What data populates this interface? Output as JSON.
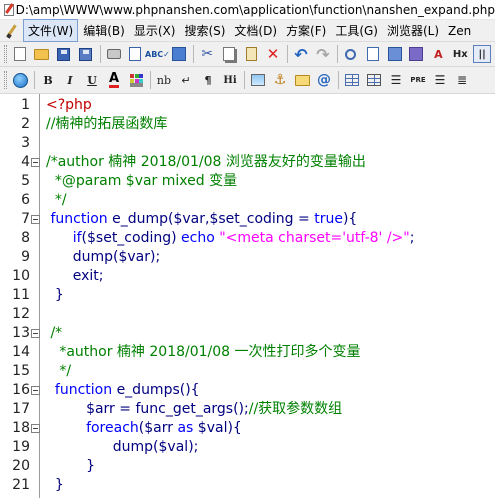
{
  "window": {
    "title": "D:\\amp\\WWW\\www.phpnanshen.com\\application\\function\\nanshen_expand.php"
  },
  "menu": [
    {
      "label": "文件(W)",
      "active": true
    },
    {
      "label": "编辑(B)"
    },
    {
      "label": "显示(X)"
    },
    {
      "label": "搜索(S)"
    },
    {
      "label": "文档(D)"
    },
    {
      "label": "方案(F)"
    },
    {
      "label": "工具(G)"
    },
    {
      "label": "浏览器(L)"
    },
    {
      "label": "Zen"
    }
  ],
  "toolbar1": [
    "new-document-icon",
    "open-folder-icon",
    "save-icon",
    "save-all-icon",
    "print-icon",
    "print-preview-icon",
    "spellcheck-icon",
    "validate-icon",
    "cut-icon",
    "copy-icon",
    "paste-icon",
    "delete-icon",
    "undo-icon",
    "redo-icon",
    "find-icon",
    "replace-icon",
    "goto-icon",
    "tag-icon",
    "heading-icon",
    "hx-icon",
    "h1-icon"
  ],
  "toolbar2": {
    "bold": "B",
    "italic": "I",
    "underline": "U",
    "nbsp": "nb",
    "pilcrow": "¶",
    "hi": "Hi",
    "pre": "PRE"
  },
  "code_lines": [
    {
      "n": "1",
      "fold": false,
      "segs": [
        [
          "php",
          "<?php"
        ]
      ]
    },
    {
      "n": "2",
      "fold": false,
      "segs": [
        [
          "cmt",
          "//楠神的拓展函数库"
        ]
      ]
    },
    {
      "n": "3",
      "fold": false,
      "segs": []
    },
    {
      "n": "4",
      "fold": true,
      "segs": [
        [
          "cmt",
          "/*author 楠神 2018/01/08 浏览器友好的变量输出"
        ]
      ]
    },
    {
      "n": "5",
      "fold": false,
      "segs": [
        [
          "cmt",
          "  *@param $var mixed 变量"
        ]
      ]
    },
    {
      "n": "6",
      "fold": false,
      "segs": [
        [
          "cmt",
          "  */"
        ]
      ]
    },
    {
      "n": "7",
      "fold": true,
      "segs": [
        [
          "bk",
          " "
        ],
        [
          "kw",
          "function"
        ],
        [
          "bk",
          " "
        ],
        [
          "fn",
          "e_dump("
        ],
        [
          "var",
          "$var"
        ],
        [
          "fn",
          ","
        ],
        [
          "var",
          "$set_coding"
        ],
        [
          "fn",
          " = "
        ],
        [
          "kw",
          "true"
        ],
        [
          "fn",
          "){"
        ]
      ]
    },
    {
      "n": "8",
      "fold": false,
      "segs": [
        [
          "bk",
          "      "
        ],
        [
          "kw",
          "if"
        ],
        [
          "fn",
          "("
        ],
        [
          "var",
          "$set_coding"
        ],
        [
          "fn",
          ") "
        ],
        [
          "kw",
          "echo"
        ],
        [
          "fn",
          " "
        ],
        [
          "str",
          "\"<meta charset='utf-8' />\""
        ],
        [
          "fn",
          ";"
        ]
      ]
    },
    {
      "n": "9",
      "fold": false,
      "segs": [
        [
          "bk",
          "      "
        ],
        [
          "fn",
          "dump("
        ],
        [
          "var",
          "$var"
        ],
        [
          "fn",
          ");"
        ]
      ]
    },
    {
      "n": "10",
      "fold": false,
      "segs": [
        [
          "bk",
          "      "
        ],
        [
          "fn",
          "exit;"
        ]
      ]
    },
    {
      "n": "11",
      "fold": false,
      "segs": [
        [
          "bk",
          "  "
        ],
        [
          "fn",
          "}"
        ]
      ]
    },
    {
      "n": "12",
      "fold": false,
      "segs": []
    },
    {
      "n": "13",
      "fold": true,
      "segs": [
        [
          "cmt",
          " /*"
        ]
      ]
    },
    {
      "n": "14",
      "fold": false,
      "segs": [
        [
          "cmt",
          "   *author 楠神 2018/01/08 一次性打印多个变量"
        ]
      ]
    },
    {
      "n": "15",
      "fold": false,
      "segs": [
        [
          "cmt",
          "   */"
        ]
      ]
    },
    {
      "n": "16",
      "fold": true,
      "segs": [
        [
          "bk",
          "  "
        ],
        [
          "kw",
          "function"
        ],
        [
          "bk",
          " "
        ],
        [
          "fn",
          "e_dumps(){"
        ]
      ]
    },
    {
      "n": "17",
      "fold": false,
      "segs": [
        [
          "bk",
          "         "
        ],
        [
          "var",
          "$arr"
        ],
        [
          "fn",
          " = func_get_args();"
        ],
        [
          "cmt",
          "//获取参数数组"
        ]
      ]
    },
    {
      "n": "18",
      "fold": true,
      "segs": [
        [
          "bk",
          "         "
        ],
        [
          "kw",
          "foreach"
        ],
        [
          "fn",
          "("
        ],
        [
          "var",
          "$arr"
        ],
        [
          "fn",
          " "
        ],
        [
          "kw",
          "as"
        ],
        [
          "fn",
          " "
        ],
        [
          "var",
          "$val"
        ],
        [
          "fn",
          "){"
        ]
      ]
    },
    {
      "n": "19",
      "fold": false,
      "segs": [
        [
          "bk",
          "               "
        ],
        [
          "fn",
          "dump("
        ],
        [
          "var",
          "$val"
        ],
        [
          "fn",
          ");"
        ]
      ]
    },
    {
      "n": "20",
      "fold": false,
      "segs": [
        [
          "bk",
          "         "
        ],
        [
          "fn",
          "}"
        ]
      ]
    },
    {
      "n": "21",
      "fold": false,
      "segs": [
        [
          "bk",
          "  "
        ],
        [
          "fn",
          "}"
        ]
      ]
    }
  ],
  "colors": {
    "comment": "#008000",
    "keyword": "#0000ff",
    "variable": "#000080",
    "string": "#ff00ff",
    "php_tag": "#c00000"
  }
}
